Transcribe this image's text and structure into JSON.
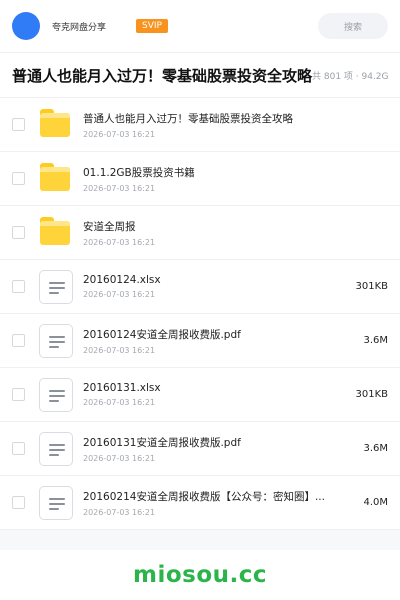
{
  "header": {
    "owner": "夸克网盘分享",
    "vip": "SVIP",
    "search_placeholder": "搜索",
    "accent_color": "#2f7cf6",
    "vip_color": "#f7931e"
  },
  "share": {
    "title": "普通人也能月入过万！零基础股票投资全攻略",
    "stats": "共 801 项 · 94.2G"
  },
  "files": [
    {
      "type": "folder",
      "name": "普通人也能月入过万！零基础股票投资全攻略",
      "date": "2026-07-03 16:21",
      "size": ""
    },
    {
      "type": "folder",
      "name": "01.1.2GB股票投资书籍",
      "date": "2026-07-03 16:21",
      "size": ""
    },
    {
      "type": "folder",
      "name": "安道全周报",
      "date": "2026-07-03 16:21",
      "size": ""
    },
    {
      "type": "file",
      "name": "20160124.xlsx",
      "date": "2026-07-03 16:21",
      "size": "301KB"
    },
    {
      "type": "file",
      "name": "20160124安道全周报收费版.pdf",
      "date": "2026-07-03 16:21",
      "size": "3.6M"
    },
    {
      "type": "file",
      "name": "20160131.xlsx",
      "date": "2026-07-03 16:21",
      "size": "301KB"
    },
    {
      "type": "file",
      "name": "20160131安道全周报收费版.pdf",
      "date": "2026-07-03 16:21",
      "size": "3.6M"
    },
    {
      "type": "file",
      "name": "20160214安道全周报收费版【公众号：密知圈】...",
      "date": "2026-07-03 16:21",
      "size": "4.0M"
    }
  ],
  "footer": {
    "brand": "miosou.cc",
    "brand_color": "#2bb44a"
  }
}
